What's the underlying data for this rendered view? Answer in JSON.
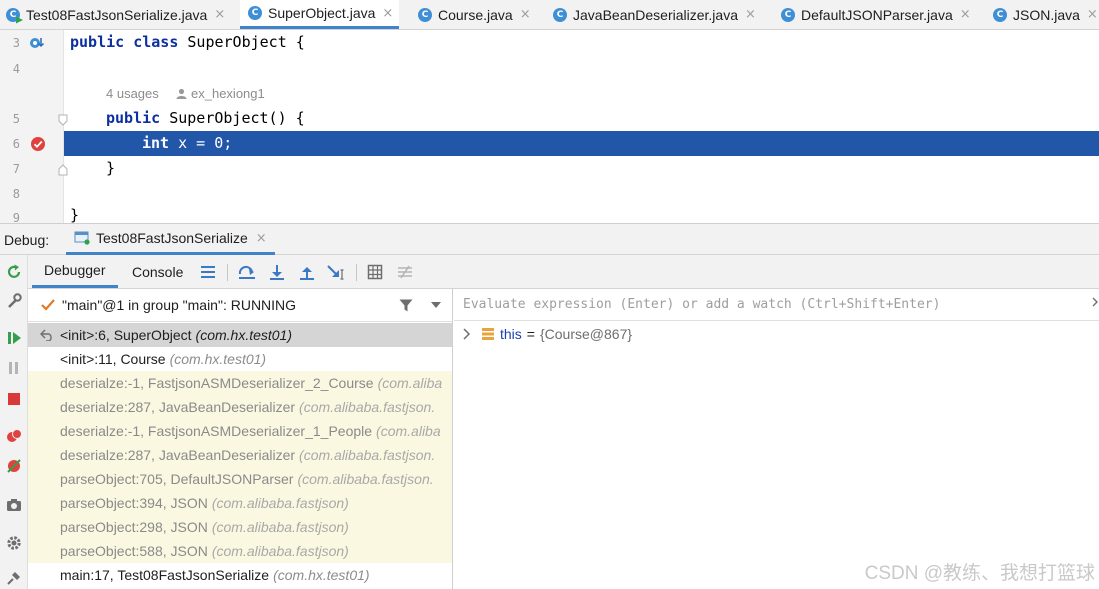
{
  "tabs": [
    {
      "label": "Test08FastJsonSerialize.java",
      "icon": "class-main-icon",
      "active": false
    },
    {
      "label": "SuperObject.java",
      "icon": "class-icon",
      "active": true
    },
    {
      "label": "Course.java",
      "icon": "class-icon",
      "active": false
    },
    {
      "label": "JavaBeanDeserializer.java",
      "icon": "class-icon",
      "active": false
    },
    {
      "label": "DefaultJSONParser.java",
      "icon": "class-icon",
      "active": false
    },
    {
      "label": "JSON.java",
      "icon": "class-icon",
      "active": false
    }
  ],
  "tab_close_glyph": "×",
  "editor": {
    "line_numbers": [
      "3",
      "4",
      "5",
      "6",
      "7",
      "8",
      "9"
    ],
    "line3": {
      "kw1": "public",
      "kw2": "class",
      "rest": "SuperObject {"
    },
    "hint_usages": "4 usages",
    "hint_author": "ex_hexiong1",
    "line5": {
      "kw1": "public",
      "rest": "SuperObject() {"
    },
    "line6": {
      "kw1": "int",
      "rest": "x = 0;"
    },
    "line7": "}",
    "line9": "}",
    "highlight_color": "#2256a8"
  },
  "debug": {
    "label": "Debug:",
    "session_tab": "Test08FastJsonSerialize",
    "debugger_tab": "Debugger",
    "console_tab": "Console"
  },
  "thread": {
    "name": "\"main\"@1 in group \"main\": RUNNING"
  },
  "frames": [
    {
      "name": "<init>:6, SuperObject",
      "pkg": "(com.hx.test01)",
      "kind": "selected"
    },
    {
      "name": "<init>:11, Course",
      "pkg": "(com.hx.test01)",
      "kind": "normal"
    },
    {
      "name": "deserialze:-1, FastjsonASMDeserializer_2_Course",
      "pkg": "(com.aliba",
      "kind": "lib"
    },
    {
      "name": "deserialze:287, JavaBeanDeserializer",
      "pkg": "(com.alibaba.fastjson.",
      "kind": "lib"
    },
    {
      "name": "deserialze:-1, FastjsonASMDeserializer_1_People",
      "pkg": "(com.aliba",
      "kind": "lib"
    },
    {
      "name": "deserialze:287, JavaBeanDeserializer",
      "pkg": "(com.alibaba.fastjson.",
      "kind": "lib"
    },
    {
      "name": "parseObject:705, DefaultJSONParser",
      "pkg": "(com.alibaba.fastjson.",
      "kind": "lib"
    },
    {
      "name": "parseObject:394, JSON",
      "pkg": "(com.alibaba.fastjson)",
      "kind": "lib"
    },
    {
      "name": "parseObject:298, JSON",
      "pkg": "(com.alibaba.fastjson)",
      "kind": "lib"
    },
    {
      "name": "parseObject:588, JSON",
      "pkg": "(com.alibaba.fastjson)",
      "kind": "lib"
    },
    {
      "name": "main:17, Test08FastJsonSerialize",
      "pkg": "(com.hx.test01)",
      "kind": "normal"
    }
  ],
  "evaluate": {
    "placeholder": "Evaluate expression (Enter) or add a watch (Ctrl+Shift+Enter)"
  },
  "variables": [
    {
      "name": "this",
      "eq": "=",
      "value": "{Course@867}"
    }
  ],
  "watermark": "CSDN @教练、我想打篮球",
  "colors": {
    "accent": "#4083c9",
    "library_frame_bg": "#fbf8e1",
    "selected_frame_bg": "#d5d5d5"
  }
}
